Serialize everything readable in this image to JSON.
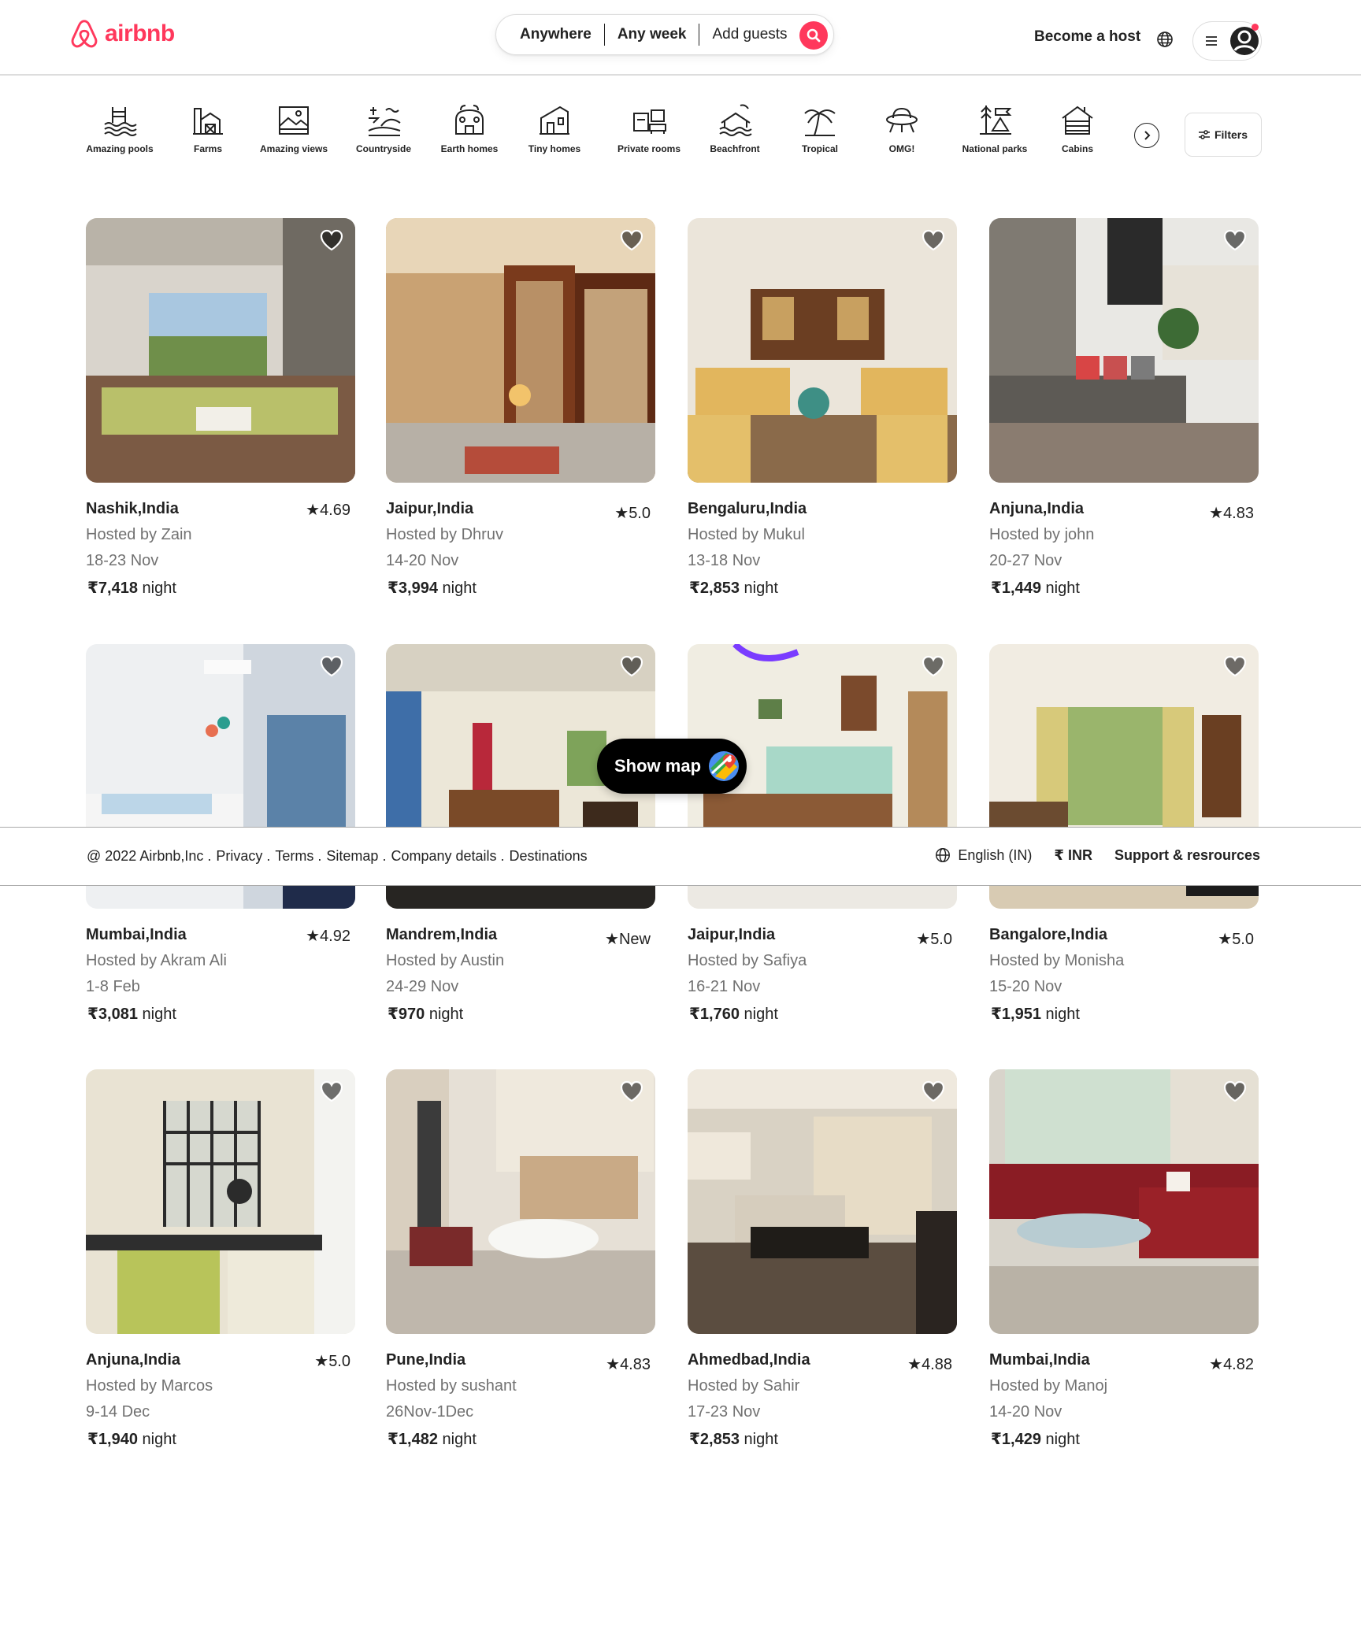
{
  "brand": {
    "name": "airbnb",
    "color": "#ff385c"
  },
  "search": {
    "location": "Anywhere",
    "week": "Any week",
    "guests": "Add guests",
    "search_icon": "search-icon"
  },
  "header": {
    "become_host": "Become a host",
    "globe_icon": "globe-icon",
    "menu_icon": "menu-icon",
    "avatar_icon": "user-avatar-icon"
  },
  "categories": [
    {
      "label": "Amazing pools",
      "icon": "pool-icon"
    },
    {
      "label": "Farms",
      "icon": "farm-icon"
    },
    {
      "label": "Amazing views",
      "icon": "view-icon"
    },
    {
      "label": "Countryside",
      "icon": "countryside-icon"
    },
    {
      "label": "Earth homes",
      "icon": "earth-home-icon"
    },
    {
      "label": "Tiny homes",
      "icon": "tiny-home-icon"
    },
    {
      "label": "Private rooms",
      "icon": "private-room-icon"
    },
    {
      "label": "Beachfront",
      "icon": "beach-icon"
    },
    {
      "label": "Tropical",
      "icon": "palm-icon"
    },
    {
      "label": "OMG!",
      "icon": "ufo-icon"
    },
    {
      "label": "National parks",
      "icon": "park-icon"
    },
    {
      "label": "Cabins",
      "icon": "cabin-icon"
    }
  ],
  "filters": {
    "label": "Filters"
  },
  "listings": [
    {
      "location": "Nashik,India",
      "rating": "4.69",
      "host": "Hosted by Zain",
      "dates": "18-23 Nov",
      "price": "₹7,418",
      "unit": " night"
    },
    {
      "location": "Jaipur,India",
      "rating": "5.0",
      "host": "Hosted by Dhruv",
      "dates": "14-20 Nov",
      "price": "₹3,994",
      "unit": " night"
    },
    {
      "location": "Bengaluru,India",
      "rating": "",
      "host": "Hosted by Mukul",
      "dates": "13-18 Nov",
      "price": "₹2,853",
      "unit": " night"
    },
    {
      "location": "Anjuna,India",
      "rating": "4.83",
      "host": "Hosted by john",
      "dates": "20-27 Nov",
      "price": "₹1,449",
      "unit": " night"
    },
    {
      "location": "Mumbai,India",
      "rating": "4.92",
      "host": "Hosted by Akram Ali",
      "dates": "1-8 Feb",
      "price": "₹3,081",
      "unit": " night"
    },
    {
      "location": "Mandrem,India",
      "rating": "New",
      "host": "Hosted by Austin",
      "dates": "24-29 Nov",
      "price": "₹970",
      "unit": " night"
    },
    {
      "location": "Jaipur,India",
      "rating": "5.0",
      "host": "Hosted by Safiya",
      "dates": "16-21 Nov",
      "price": "₹1,760",
      "unit": " night"
    },
    {
      "location": "Bangalore,India",
      "rating": "5.0",
      "host": "Hosted by Monisha",
      "dates": "15-20 Nov",
      "price": "₹1,951",
      "unit": " night"
    },
    {
      "location": "Anjuna,India",
      "rating": "5.0",
      "host": "Hosted by Marcos",
      "dates": "9-14 Dec",
      "price": "₹1,940",
      "unit": " night"
    },
    {
      "location": "Pune,India",
      "rating": "4.83",
      "host": "Hosted by sushant",
      "dates": "26Nov-1Dec",
      "price": "₹1,482",
      "unit": " night"
    },
    {
      "location": "Ahmedbad,India",
      "rating": "4.88",
      "host": "Hosted by Sahir",
      "dates": "17-23 Nov",
      "price": "₹2,853",
      "unit": " night"
    },
    {
      "location": "Mumbai,India",
      "rating": "4.82",
      "host": "Hosted by Manoj",
      "dates": "14-20 Nov",
      "price": "₹1,429",
      "unit": " night"
    }
  ],
  "show_map": {
    "label": "Show map"
  },
  "footer": {
    "copyright": "@ 2022 Airbnb,Inc .",
    "links": [
      "Privacy .",
      "Terms .",
      "Sitemap .",
      "Company details .",
      "Destinations"
    ],
    "language": "English (IN)",
    "currency": "₹  INR",
    "support": "Support & resrources"
  }
}
